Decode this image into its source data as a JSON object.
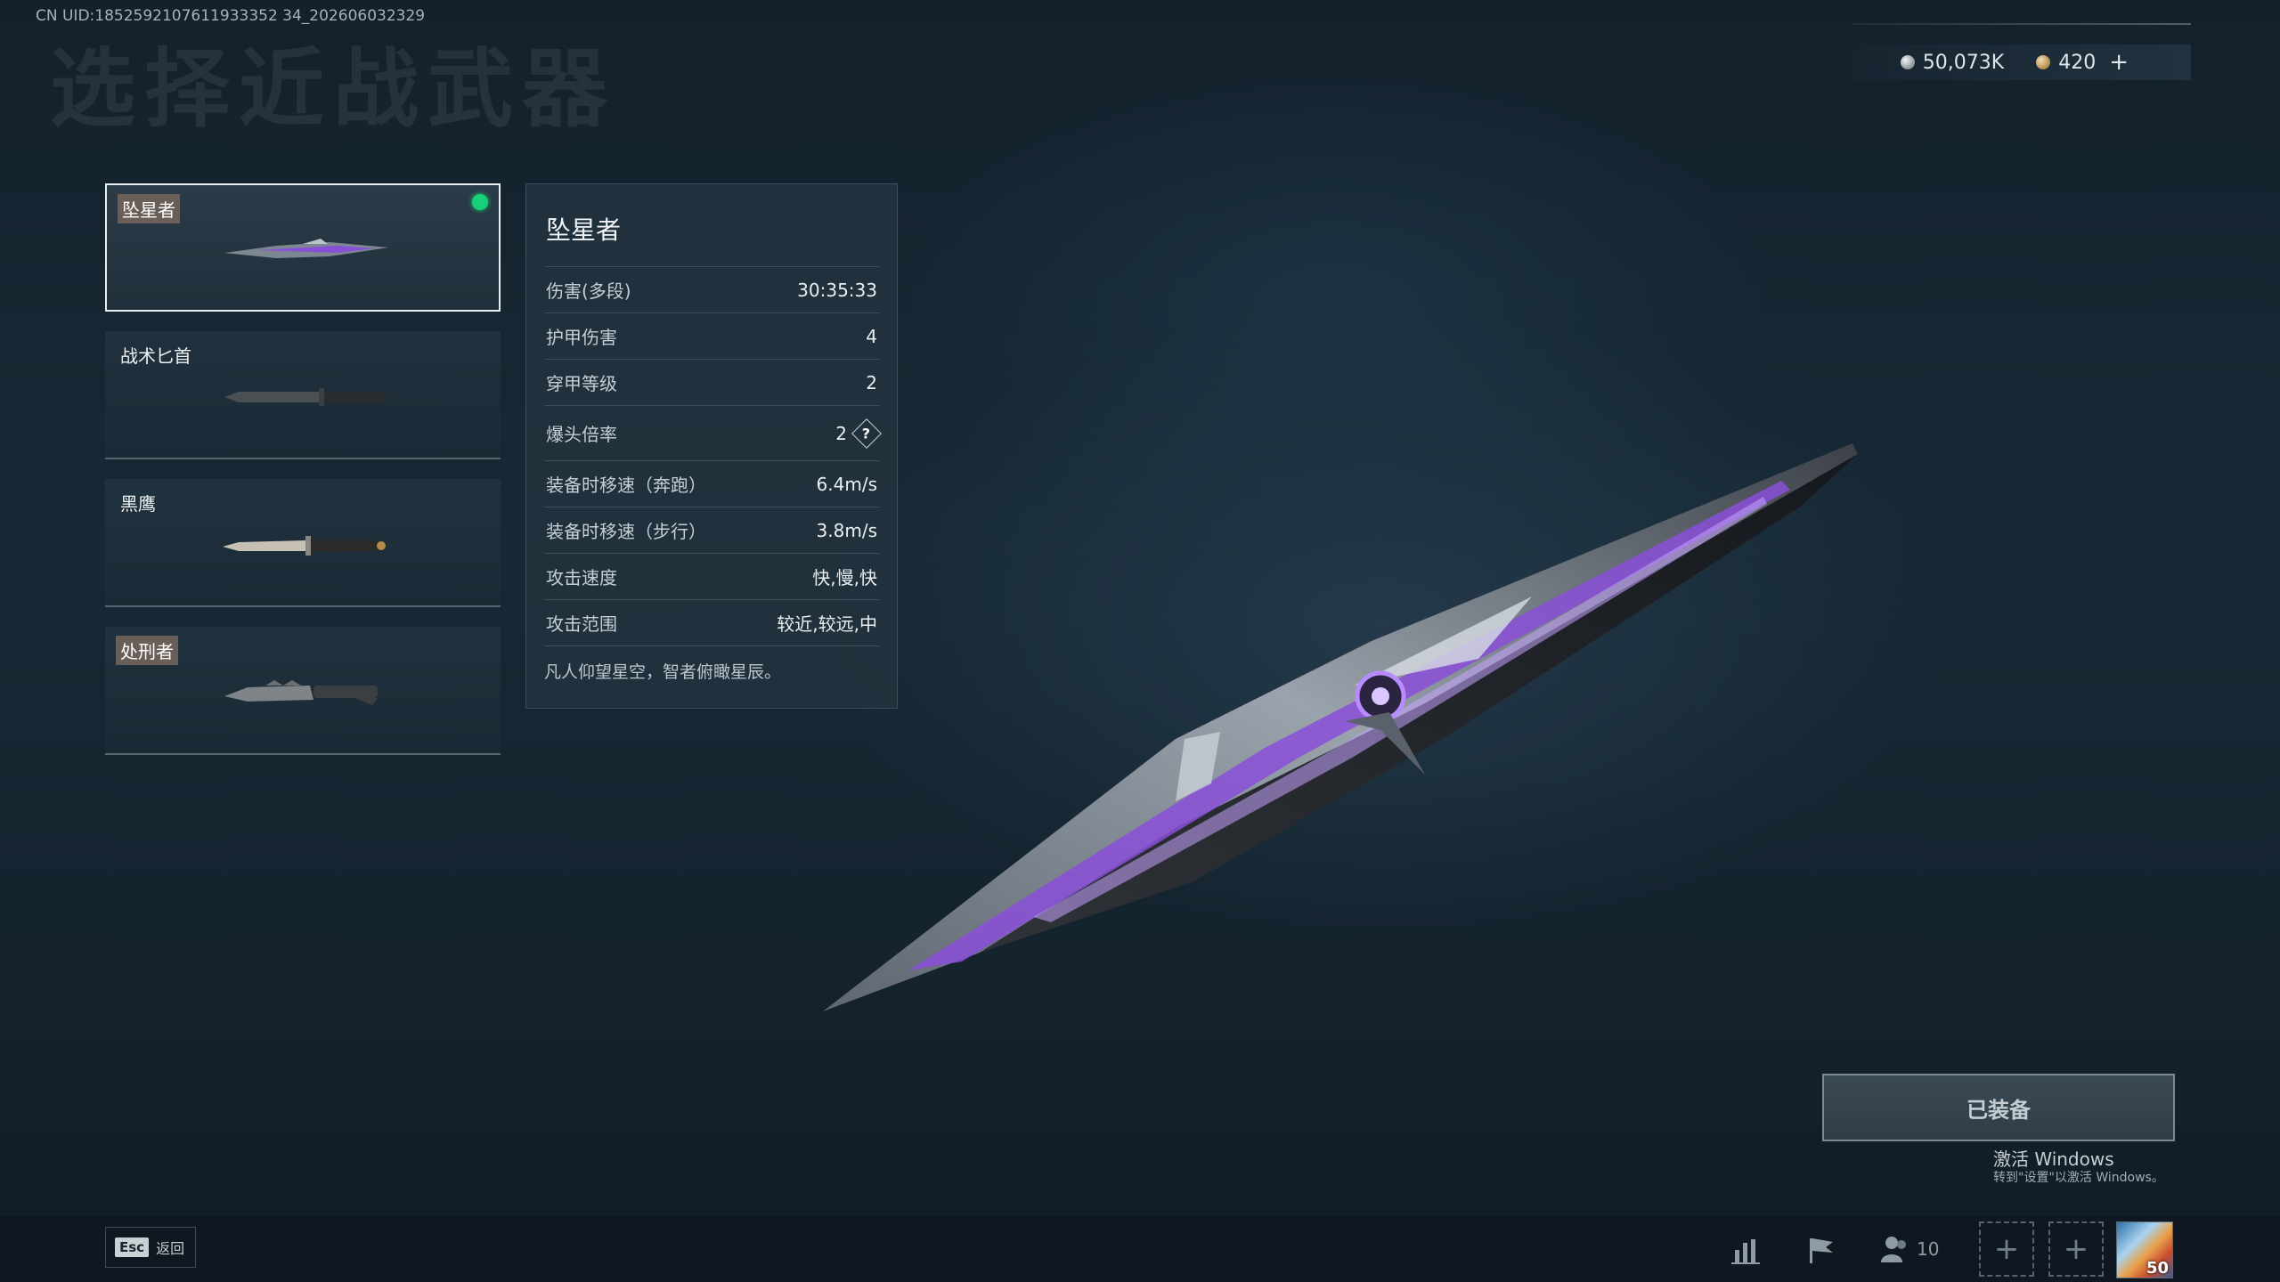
{
  "uid_text": "CN UID:1852592107611933352 34_202606032329",
  "page_title": "选择近战武器",
  "currency": {
    "silver": "50,073K",
    "gold": "420",
    "add_label": "+"
  },
  "weapons": [
    {
      "name": "坠星者",
      "tagged": true,
      "selected": true,
      "equipped": true
    },
    {
      "name": "战术匕首",
      "tagged": false,
      "selected": false,
      "equipped": false
    },
    {
      "name": "黑鹰",
      "tagged": false,
      "selected": false,
      "equipped": false
    },
    {
      "name": "处刑者",
      "tagged": true,
      "selected": false,
      "equipped": false
    }
  ],
  "stats": {
    "title": "坠星者",
    "rows": [
      {
        "label": "伤害(多段)",
        "value": "30:35:33"
      },
      {
        "label": "护甲伤害",
        "value": "4"
      },
      {
        "label": "穿甲等级",
        "value": "2"
      },
      {
        "label": "爆头倍率",
        "value": "2",
        "help": "?"
      },
      {
        "label": "装备时移速（奔跑）",
        "value": "6.4m/s"
      },
      {
        "label": "装备时移速（步行）",
        "value": "3.8m/s"
      },
      {
        "label": "攻击速度",
        "value": "快,慢,快"
      },
      {
        "label": "攻击范围",
        "value": "较近,较远,中"
      }
    ],
    "description": "凡人仰望星空，智者俯瞰星辰。"
  },
  "equip_button_label": "已装备",
  "activate_windows": {
    "title": "激活 Windows",
    "subtitle": "转到\"设置\"以激活 Windows。"
  },
  "bottom_bar": {
    "esc_key": "Esc",
    "esc_label": "返回",
    "friends_count": "10",
    "avatar_level": "50"
  },
  "colors": {
    "equipped_dot": "#19d07a",
    "accent_purple": "#8a4fd8"
  }
}
